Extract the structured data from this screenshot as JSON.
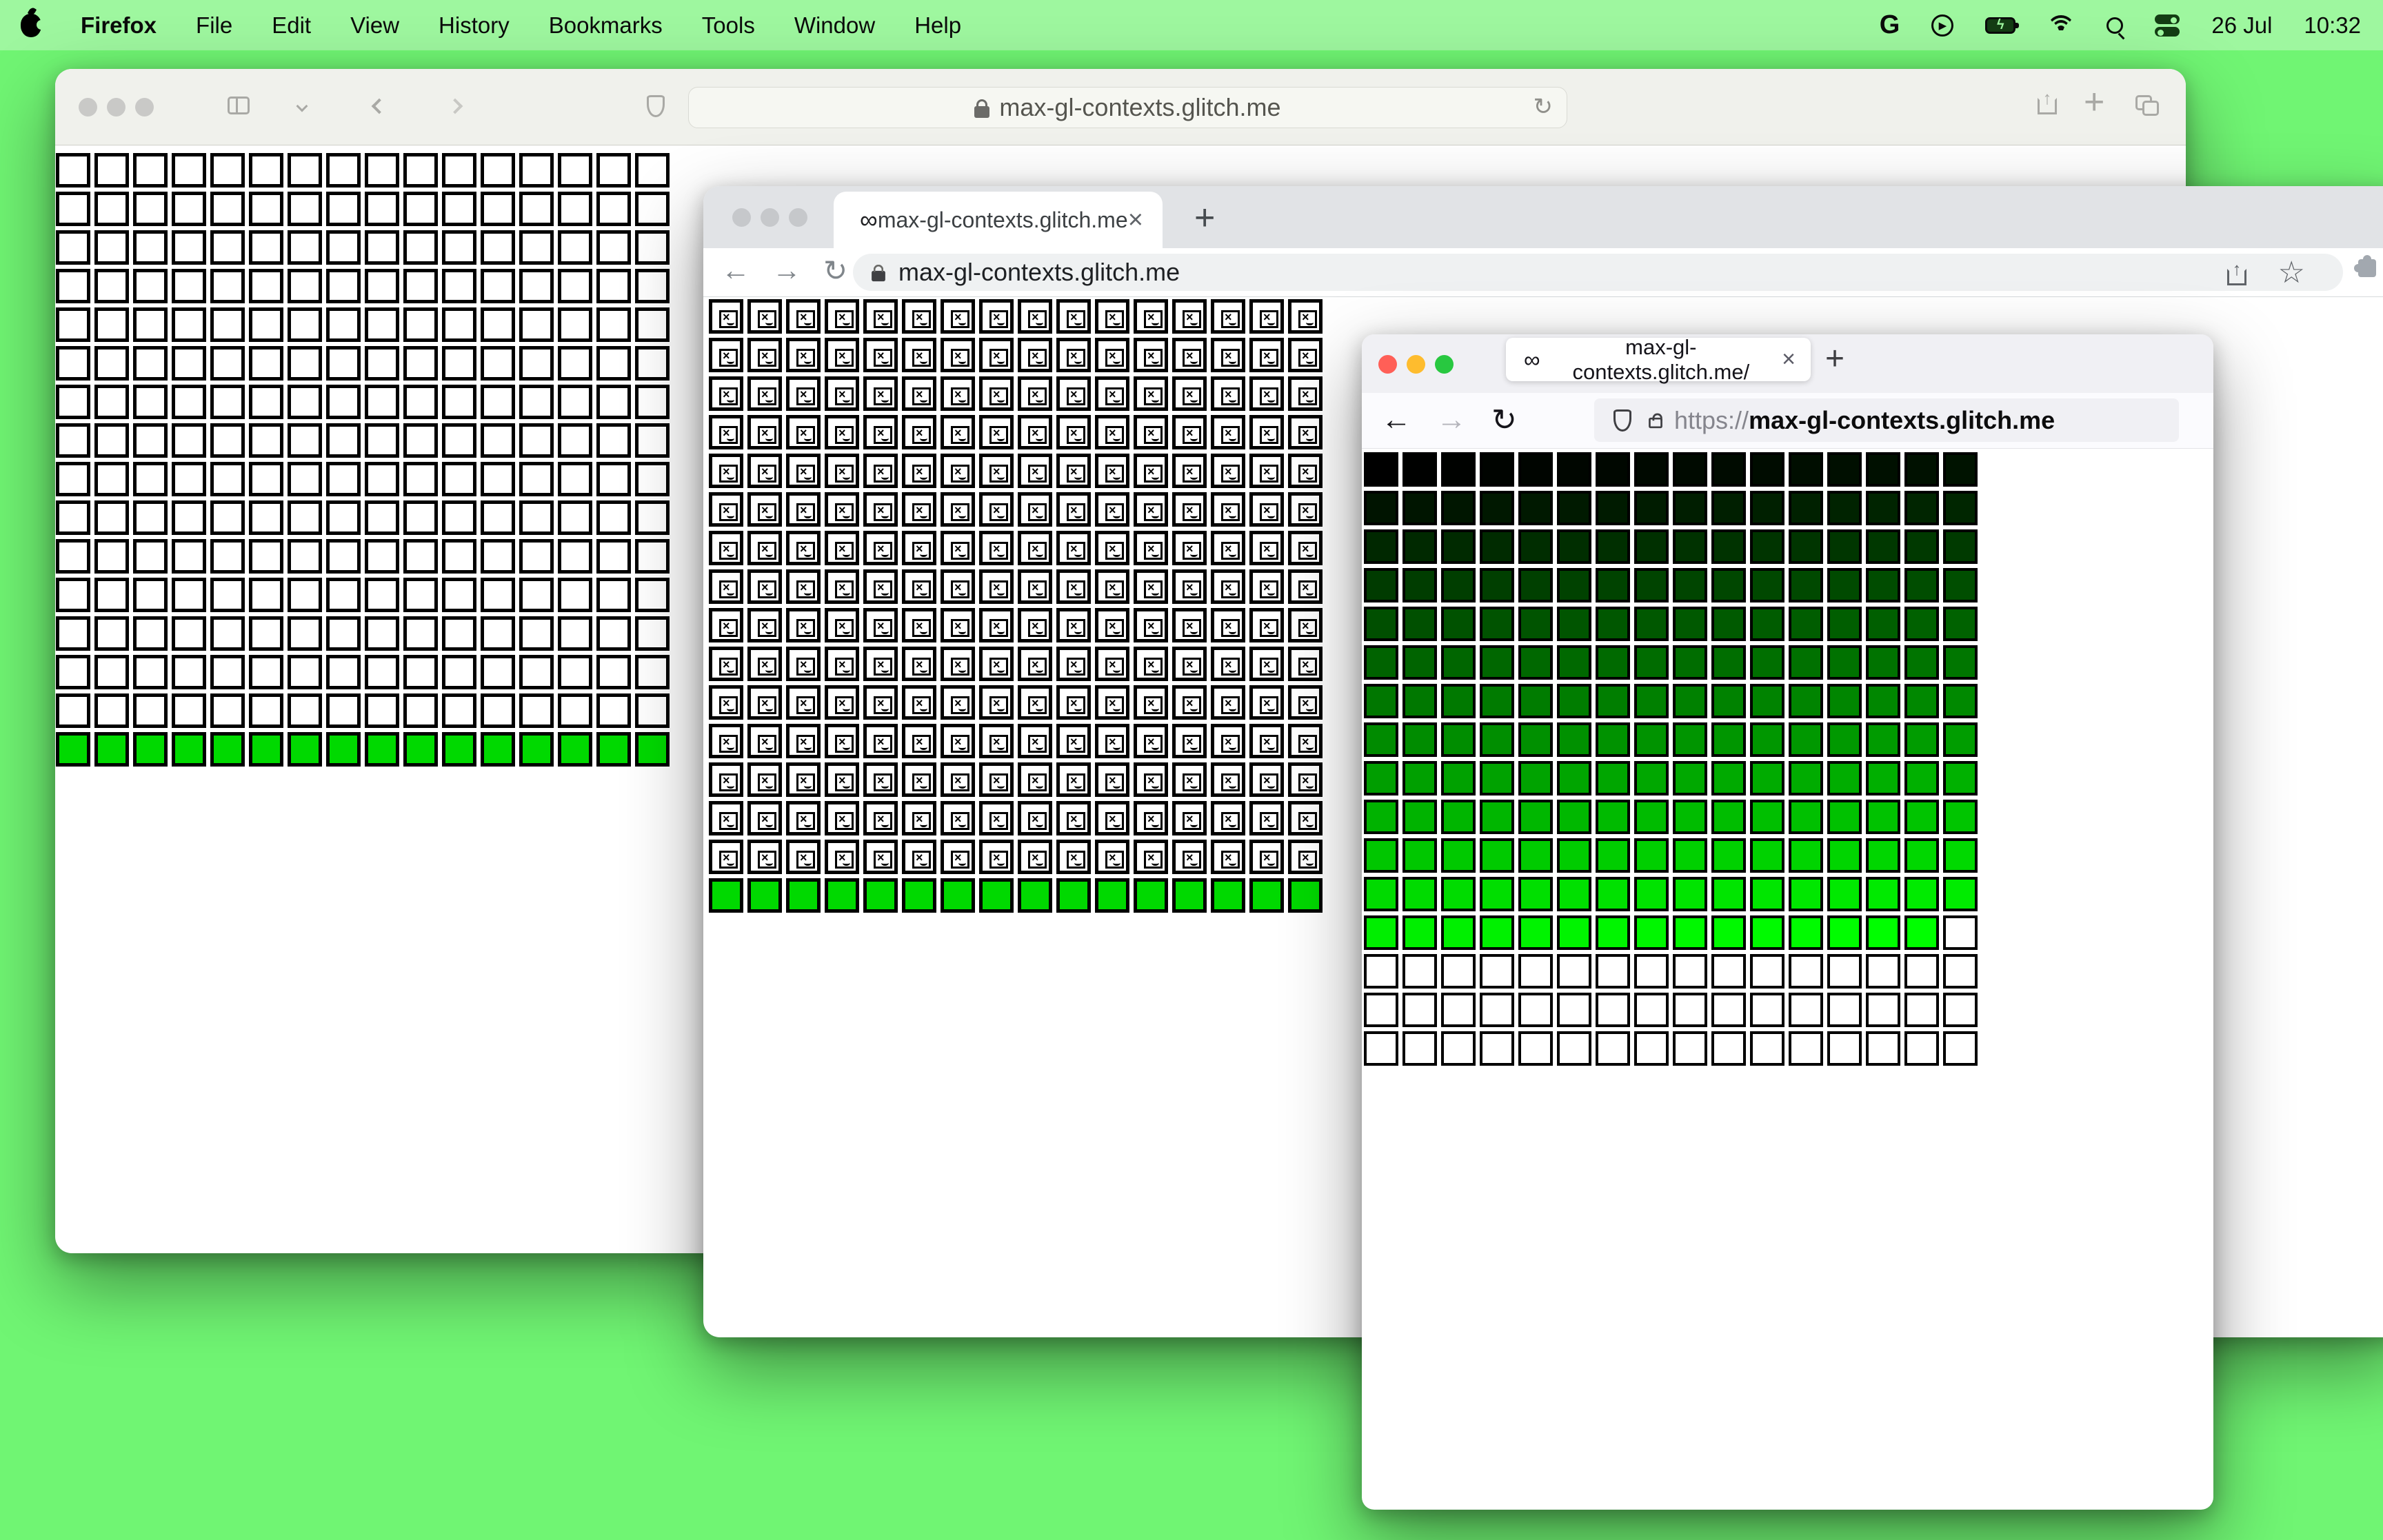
{
  "desktop": {
    "background_color": "#70f573",
    "menubar_color": "#9ef79f"
  },
  "menubar": {
    "app_name": "Firefox",
    "menus": [
      "File",
      "Edit",
      "View",
      "History",
      "Bookmarks",
      "Tools",
      "Window",
      "Help"
    ],
    "date": "26 Jul",
    "time": "10:32"
  },
  "icons": {
    "google": "G",
    "play": "▶",
    "battery_bolt": "ϟ",
    "infinity_favicon": "∞",
    "close": "×",
    "new_tab": "+",
    "back_arrow": "←",
    "forward_arrow": "→",
    "reload": "↻",
    "star": "☆"
  },
  "safari_window": {
    "url": "max-gl-contexts.glitch.me"
  },
  "chrome_window": {
    "tab_favicon": "∞",
    "tab_title": "max-gl-contexts.glitch.me",
    "url": "max-gl-contexts.glitch.me"
  },
  "firefox_window": {
    "tab_favicon": "∞",
    "tab_title": "max-gl-contexts.glitch.me/",
    "url_scheme": "https://",
    "url_domain": "max-gl-contexts.glitch.me"
  },
  "grids": {
    "safari": {
      "type": "canvas-grid",
      "cols": 16,
      "rows": 16,
      "empty_color": "#ffffff",
      "active_color": "#00d900",
      "active_cells_start": 240,
      "description": "15 rows of blank white canvases, bottom row of live green canvases"
    },
    "chrome": {
      "type": "canvas-grid",
      "cols": 16,
      "rows": 16,
      "cell_style": "broken-image",
      "empty_color": "#ffffff",
      "active_color": "#00d900",
      "active_cells_start": 240,
      "description": "15 rows of broken-image canvases, bottom row of live green canvases"
    },
    "firefox": {
      "type": "canvas-grid",
      "cols": 16,
      "rows": 16,
      "gradient_cells": 207,
      "gradient_from": "#000000",
      "gradient_to": "#00ff00",
      "remaining_color": "#ffffff",
      "description": "row-major brightness ramp black to green over 207 canvases, rest blank white"
    }
  }
}
